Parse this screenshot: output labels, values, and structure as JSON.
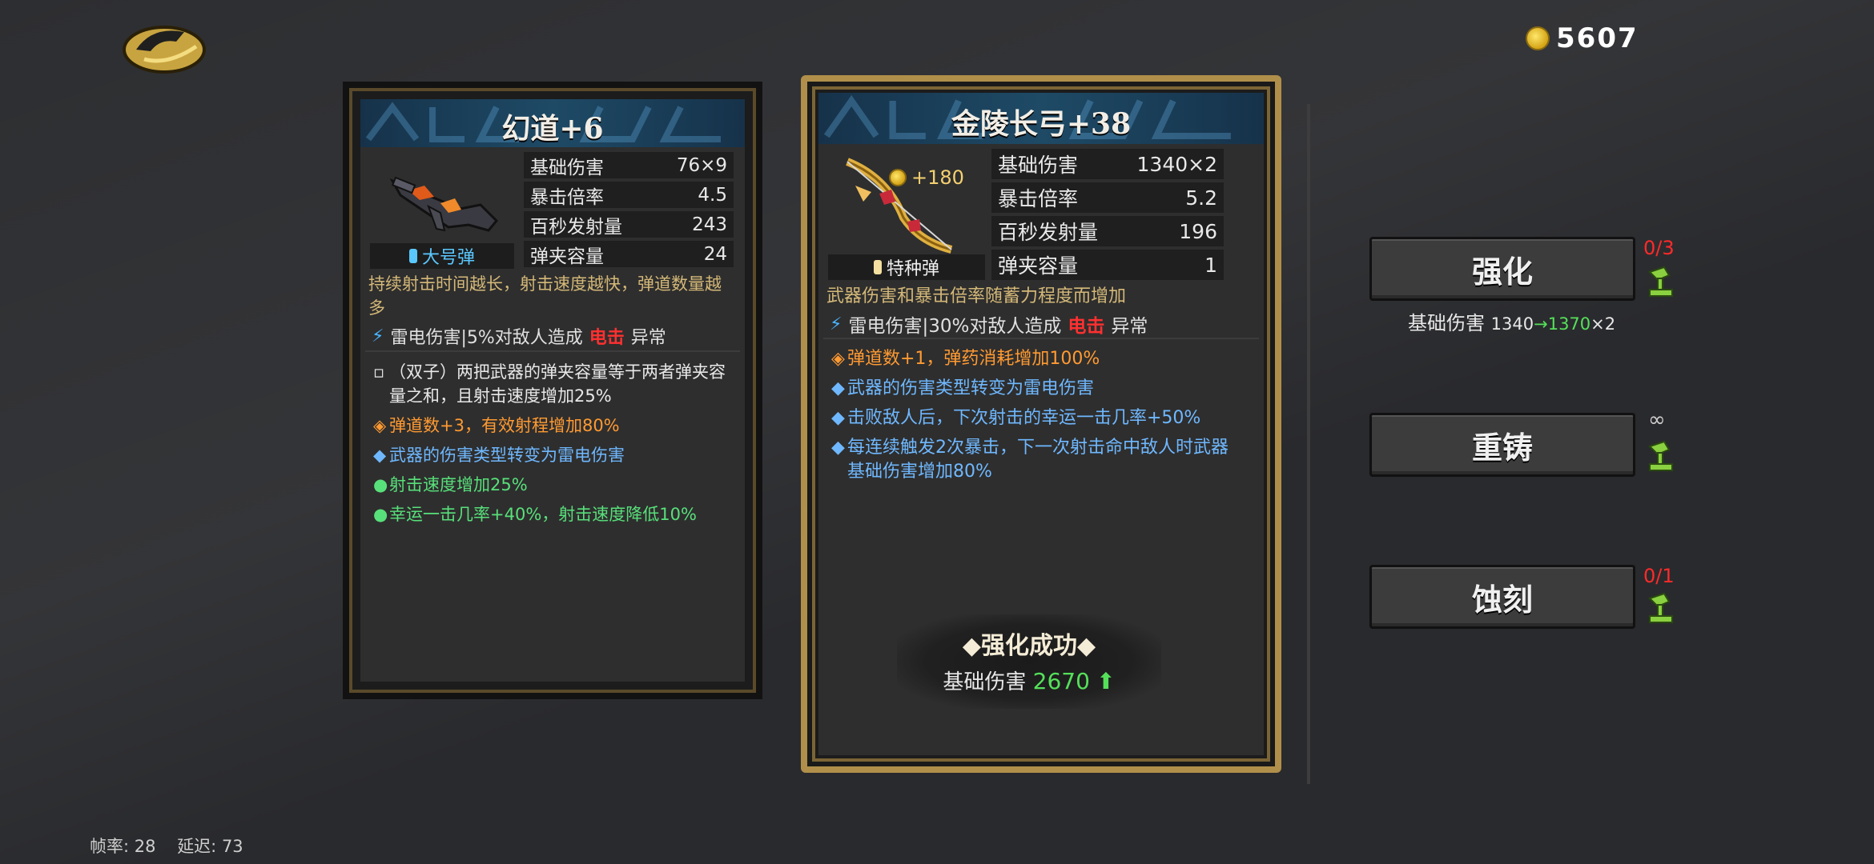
{
  "header": {
    "coins": "5607"
  },
  "left_card": {
    "title": "幻道+6",
    "ammo": "大号弹",
    "stats": [
      {
        "label": "基础伤害",
        "value": "76×9"
      },
      {
        "label": "暴击倍率",
        "value": "4.5"
      },
      {
        "label": "百秒发射量",
        "value": "243"
      },
      {
        "label": "弹夹容量",
        "value": "24"
      }
    ],
    "description": "持续射击时间越长，射击速度越快，弹道数量越多",
    "element": {
      "prefix": "雷电伤害|5%对敌人造成",
      "highlight": "电击",
      "suffix": "异常"
    },
    "traits": [
      {
        "mark": "▫",
        "text": "（双子）两把武器的弹夹容量等于两者弹夹容量之和，且射击速度增加25%",
        "color": "white"
      },
      {
        "mark": "◈",
        "text": "弹道数+3，有效射程增加80%",
        "color": "orange"
      },
      {
        "mark": "◆",
        "text": "武器的伤害类型转变为雷电伤害",
        "color": "blue"
      },
      {
        "mark": "●",
        "text": "射击速度增加25%",
        "color": "green"
      },
      {
        "mark": "●",
        "text": "幸运一击几率+40%，射击速度降低10%",
        "color": "green"
      }
    ]
  },
  "right_card": {
    "title": "金陵长弓+38",
    "price": "+180",
    "ammo": "特种弹",
    "stats": [
      {
        "label": "基础伤害",
        "value": "1340×2"
      },
      {
        "label": "暴击倍率",
        "value": "5.2"
      },
      {
        "label": "百秒发射量",
        "value": "196"
      },
      {
        "label": "弹夹容量",
        "value": "1"
      }
    ],
    "description": "武器伤害和暴击倍率随蓄力程度而增加",
    "element": {
      "prefix": "雷电伤害|30%对敌人造成",
      "highlight": "电击",
      "suffix": "异常"
    },
    "traits": [
      {
        "mark": "◈",
        "text": "弹道数+1，弹药消耗增加100%",
        "color": "orange"
      },
      {
        "mark": "◆",
        "text": "武器的伤害类型转变为雷电伤害",
        "color": "blue"
      },
      {
        "mark": "◆",
        "text": "击败敌人后，下次射击的幸运一击几率+50%",
        "color": "blue"
      },
      {
        "mark": "◆",
        "text": "每连续触发2次暴击，下一次射击命中敌人时武器基础伤害增加80%",
        "color": "blue"
      }
    ],
    "success": {
      "title": "◆强化成功◆",
      "label": "基础伤害",
      "value": "2670",
      "arrow": "⬆"
    }
  },
  "actions": {
    "enhance": {
      "label": "强化",
      "count": "0/3"
    },
    "enhance_info": {
      "label": "基础伤害",
      "from": "1340",
      "arrow": "→",
      "to": "1370",
      "suffix": "×2"
    },
    "reforge": {
      "label": "重铸",
      "count": "∞"
    },
    "engrave": {
      "label": "蚀刻",
      "count": "0/1"
    }
  },
  "footer": {
    "fps": "帧率: 28",
    "latency": "延迟: 73"
  },
  "colors": {
    "gold": "#b08f4a",
    "accent_green": "#55e05a",
    "accent_red": "#ff2a2a",
    "blue": "#6fb8ff",
    "orange": "#ff9a32"
  }
}
